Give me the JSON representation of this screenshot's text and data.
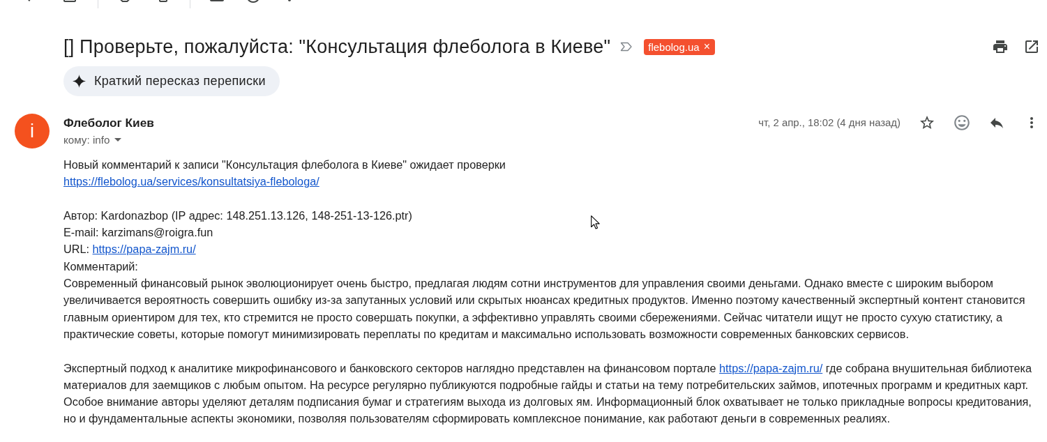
{
  "subject": {
    "text": "[] Проверьте, пожалуйста: \"Консультация флеболога в Киеве\"",
    "important": false,
    "label": {
      "text": "flebolog.ua",
      "remove": "×"
    }
  },
  "summary_button": {
    "label": "Краткий пересказ переписки"
  },
  "message": {
    "avatar_letter": "i",
    "sender": "Флеболог Киев",
    "recipient": "кому: info",
    "date": "чт, 2 апр., 18:02 (4 дня назад)",
    "starred": false,
    "body": [
      {
        "lines": [
          {
            "parts": [
              {
                "kind": "text",
                "text": "Новый комментарий к записи \"Консультация флеболога в Киеве\" ожидает проверки"
              }
            ]
          },
          {
            "parts": [
              {
                "kind": "link",
                "text": "https://flebolog.ua/services/konsultatsiya-flebologa/"
              }
            ]
          }
        ]
      },
      {
        "lines": [
          {
            "parts": [
              {
                "kind": "text",
                "text": "Автор: Kardonazbop (IP адрес: 148.251.13.126, 148-251-13-126.ptr)"
              }
            ]
          },
          {
            "parts": [
              {
                "kind": "text",
                "text": "E-mail: karzimans@roigra.fun"
              }
            ]
          },
          {
            "parts": [
              {
                "kind": "text",
                "text": "URL:"
              },
              {
                "kind": "link",
                "text": "https://papa-zajm.ru/"
              }
            ]
          },
          {
            "parts": [
              {
                "kind": "text",
                "text": "Комментарий:"
              }
            ]
          },
          {
            "parts": [
              {
                "kind": "text",
                "text": "Современный финансовый рынок эволюционирует очень быстро, предлагая людям сотни инструментов для управления своими деньгами. Однако вместе с широким выбором увеличивается вероятность совершить ошибку из-за запутанных условий или скрытых нюансах кредитных продуктов. Именно поэтому качественный экспертный контент становится главным ориентиром для тех, кто стремится не просто совершать покупки, а эффективно управлять своими сбережениями. Сейчас читатели ищут не просто сухую статистику, а практические советы, которые помогут минимизировать переплаты по кредитам и максимально использовать возможности современных банковских сервисов."
              }
            ]
          }
        ]
      },
      {
        "lines": [
          {
            "parts": [
              {
                "kind": "text",
                "text": "Экспертный подход к аналитике микрофинансового и банковского секторов наглядно представлен на финансовом портале"
              },
              {
                "kind": "link",
                "text": "https://papa-zajm.ru/"
              },
              {
                "kind": "text",
                "text": "где собрана внушительная библиотека материалов для заемщиков с любым опытом. На ресурсе регулярно публикуются подробные гайды и статьи на тему потребительских займов, ипотечных программ и кредитных карт. Особое внимание авторы уделяют деталям подписания бумаг и стратегиям выхода из долговых ям. Информационный блок охватывает не только прикладные вопросы кредитования, но и фундаментальные аспекты экономики, позволяя пользователям сформировать комплексное понимание, как работают деньги в современных реалиях."
              }
            ]
          }
        ]
      }
    ]
  }
}
